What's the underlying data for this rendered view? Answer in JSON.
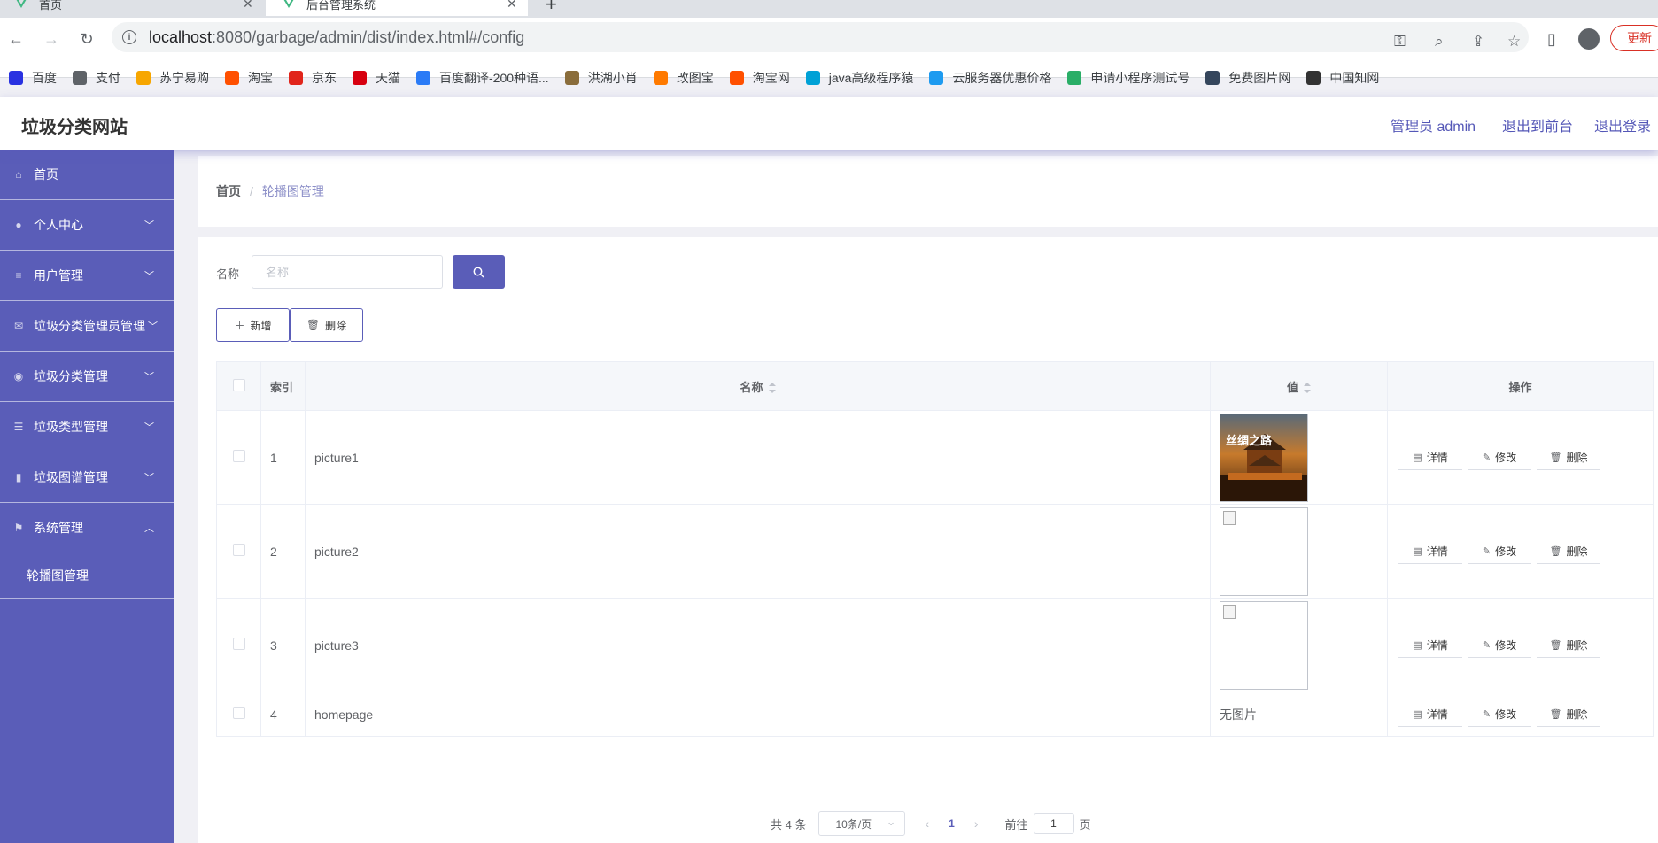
{
  "browser": {
    "tabs": [
      {
        "title": "首页",
        "active": false
      },
      {
        "title": "后台管理系统",
        "active": true
      }
    ],
    "url_host": "localhost",
    "url_rest": ":8080/garbage/admin/dist/index.html#/config",
    "update_label": "更新",
    "bookmarks": [
      {
        "label": "百度",
        "icon": "baidu-icon",
        "color": "#2932e1"
      },
      {
        "label": "支付",
        "icon": "globe-icon",
        "color": "#5f6368"
      },
      {
        "label": "苏宁易购",
        "icon": "suning-icon",
        "color": "#f7a600"
      },
      {
        "label": "淘宝",
        "icon": "taobao-icon",
        "color": "#ff5000"
      },
      {
        "label": "京东",
        "icon": "jd-icon",
        "color": "#e1251b"
      },
      {
        "label": "天猫",
        "icon": "tmall-icon",
        "color": "#d7000f"
      },
      {
        "label": "百度翻译-200种语...",
        "icon": "translate-icon",
        "color": "#2b7bf6"
      },
      {
        "label": "洪湖小肖",
        "icon": "bird-icon",
        "color": "#8a6d3b"
      },
      {
        "label": "改图宝",
        "icon": "gaitubao-icon",
        "color": "#ff7a00"
      },
      {
        "label": "淘宝网",
        "icon": "taobao-icon",
        "color": "#ff5000"
      },
      {
        "label": "java高级程序猿",
        "icon": "bilibili-icon",
        "color": "#00a1d6"
      },
      {
        "label": "云服务器优惠价格",
        "icon": "cloud-icon",
        "color": "#1e9bf0"
      },
      {
        "label": "申请小程序测试号",
        "icon": "wechat-icon",
        "color": "#2aae67"
      },
      {
        "label": "免费图片网",
        "icon": "tumblr-icon",
        "color": "#35465c"
      },
      {
        "label": "中国知网",
        "icon": "cnki-icon",
        "color": "#333333"
      }
    ]
  },
  "header": {
    "site_title": "垃圾分类网站",
    "admin_label": "管理员 admin",
    "front_label": "退出到前台",
    "logout_label": "退出登录"
  },
  "sidebar": {
    "items": [
      {
        "label": "首页",
        "icon": "home-icon",
        "has_chevron": false
      },
      {
        "label": "个人中心",
        "icon": "user-icon",
        "has_chevron": true
      },
      {
        "label": "用户管理",
        "icon": "list-icon",
        "has_chevron": true
      },
      {
        "label": "垃圾分类管理员管理",
        "icon": "mail-icon",
        "has_chevron": true
      },
      {
        "label": "垃圾分类管理",
        "icon": "location-icon",
        "has_chevron": true
      },
      {
        "label": "垃圾类型管理",
        "icon": "sliders-icon",
        "has_chevron": true
      },
      {
        "label": "垃圾图谱管理",
        "icon": "brush-icon",
        "has_chevron": true
      },
      {
        "label": "系统管理",
        "icon": "flag-icon",
        "has_chevron": true,
        "expanded": true
      }
    ],
    "sub_items": [
      {
        "label": "轮播图管理"
      }
    ]
  },
  "breadcrumb": {
    "home": "首页",
    "separator": "/",
    "current": "轮播图管理"
  },
  "search": {
    "label": "名称",
    "placeholder": "名称"
  },
  "actions": {
    "add_label": "新增",
    "delete_label": "删除"
  },
  "table": {
    "headers": {
      "index": "索引",
      "name": "名称",
      "value": "值",
      "ops": "操作"
    },
    "rows": [
      {
        "index": "1",
        "name": "picture1",
        "value_type": "image"
      },
      {
        "index": "2",
        "name": "picture2",
        "value_type": "broken-image"
      },
      {
        "index": "3",
        "name": "picture3",
        "value_type": "broken-image"
      },
      {
        "index": "4",
        "name": "homepage",
        "value_type": "text",
        "value_text": "无图片"
      }
    ],
    "op_labels": {
      "detail": "详情",
      "edit": "修改",
      "delete": "删除"
    }
  },
  "pagination": {
    "total_text": "共 4 条",
    "page_size": "10条/页",
    "current_page": "1",
    "goto_label": "前往",
    "goto_value": "1",
    "page_suffix": "页"
  },
  "colors": {
    "primary": "#5a5db8",
    "sidebar_bg": "#5a5db8",
    "link": "#5457b7"
  }
}
